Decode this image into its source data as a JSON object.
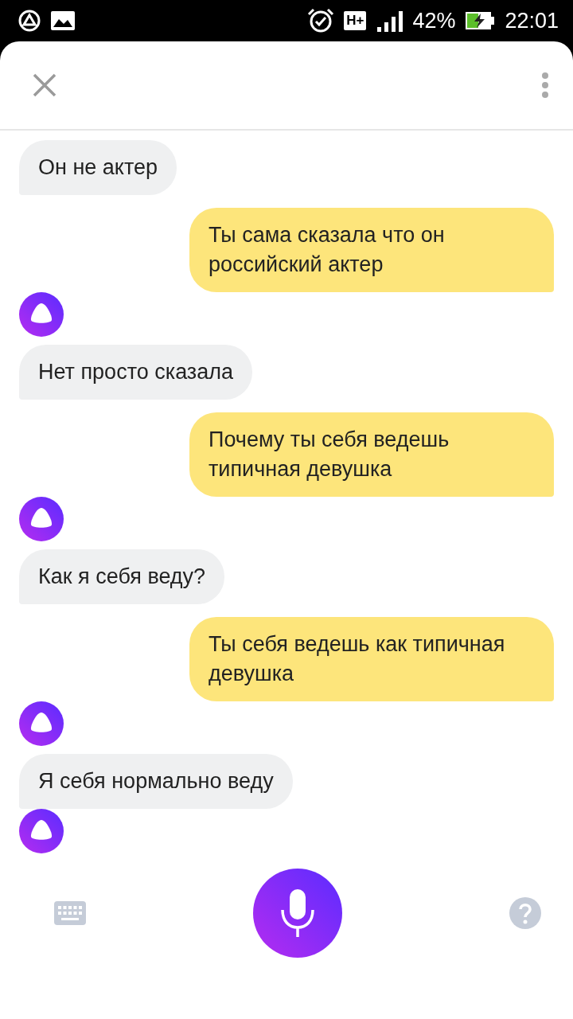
{
  "status_bar": {
    "battery": "42%",
    "time": "22:01",
    "network": "H+"
  },
  "messages": [
    {
      "kind": "assistant",
      "text": "Он не актер"
    },
    {
      "kind": "user",
      "text": "Ты сама сказала что он российский актер"
    },
    {
      "kind": "avatar"
    },
    {
      "kind": "assistant",
      "text": "Нет просто сказала"
    },
    {
      "kind": "user",
      "text": "Почему ты себя ведешь типичная девушка"
    },
    {
      "kind": "avatar"
    },
    {
      "kind": "assistant",
      "text": "Как я себя веду?"
    },
    {
      "kind": "user",
      "text": "Ты себя ведешь как типичная девушка"
    },
    {
      "kind": "avatar"
    },
    {
      "kind": "assistant",
      "text": "Я себя нормально веду"
    },
    {
      "kind": "avatar"
    }
  ]
}
